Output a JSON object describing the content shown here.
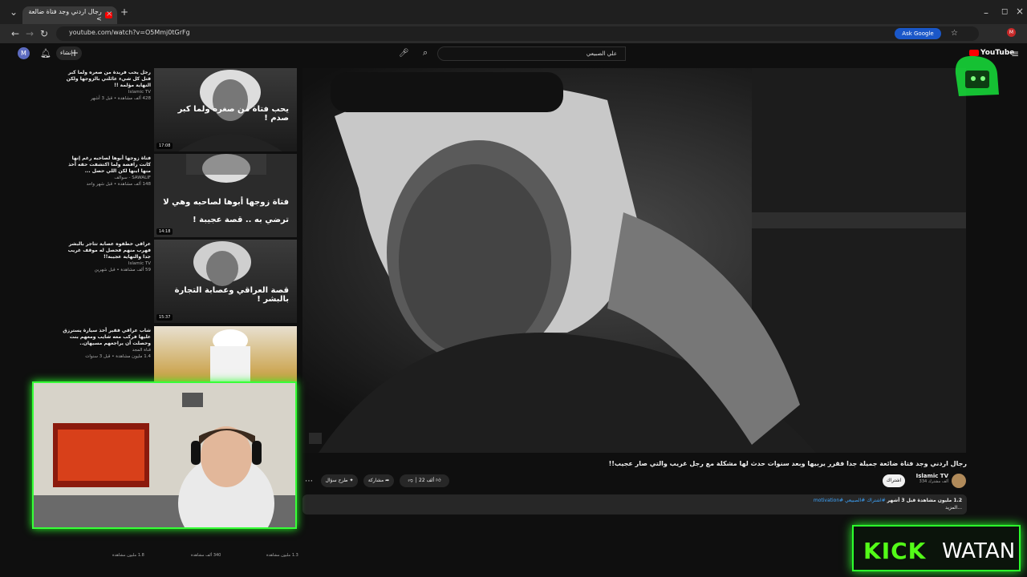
{
  "browser": {
    "tab_title": "رجال اردني وجد فتاة ضالعة >",
    "address": "youtube.com/watch?v=O5Mmj0tGrFg",
    "ask_google": "Ask Google"
  },
  "youtube": {
    "search_value": "علي الصبيعي",
    "create_label": "إنشاء",
    "avatar_letter": "M",
    "logo_text": "YouTube"
  },
  "video": {
    "title": "رجال اردني وجد فتاة ضائعة جميلة جدا فقرر يربيها وبعد سنوات حدث لها مشكلة مع رجل غريب والتي صار عجيب!!",
    "channel": "Islamic TV",
    "subscribers": "334 ألف مشترك",
    "subscribe_label": "اشتراك",
    "likes": "22 ألف",
    "share_label": "مشاركة",
    "ask_label": "طرح سؤال",
    "desc_stats": "1.2 مليون مشاهدة قبل 3 أشهر",
    "desc_tags": "#اشتراك #الصبيعي #motivation",
    "desc_more": "...المزيد"
  },
  "sidebar": [
    {
      "title": "رجل يحب فريدة من صغره ولما كبر قتل كل شيء عائلتي بالزوجها ولكن النهاية مؤلمة !!",
      "channel": "Islamic TV",
      "stats": "428 ألف مشاهدة • قبل 3 أشهر",
      "thumb_caption": "يحب فتاة من صغره ولما كبر صدم !",
      "duration": "17:08"
    },
    {
      "title": "فتاة زوجها أبوها لصاحبه رغم إنها كانت رافضة ولما اكتشفت حقه أخذ منها ابنها لكن اللي حصل ...",
      "channel": "SAWALIF - سوالف",
      "stats": "148 ألف مشاهدة • قبل شهر واحد",
      "thumb_caption": "فتاة زوجها أبوها لصاحبه وهي لا ترضي به .. قصة عجيبة !",
      "duration": "14:18"
    },
    {
      "title": "عراقي خطفوه عصابة تتاجر بالبشر فهرب منهم فحصل له موقف غريب جدا والنهاية عجيبة!!",
      "channel": "Islamic TV",
      "stats": "59 ألف مشاهدة • قبل شهرين",
      "thumb_caption": "قصة العراقي وعصابة التجارة بالبشر !",
      "duration": "15:37"
    },
    {
      "title": "شاب عراقي فقير أخذ سيارة يسترزق عليها فركب معه شايب ومعهم بنت وحصلت أن يراجعهم مسيهان..",
      "channel": "قناة المجد",
      "stats": "1.4 مليون مشاهدة • قبل 3 سنوات",
      "thumb_caption": "",
      "duration": ""
    }
  ],
  "below_stats": [
    "1.8 مليون مشاهدة",
    "340 ألف مشاهدة",
    "1.3 مليون مشاهدة"
  ],
  "overlay": {
    "kick_word": "KICK",
    "watan_word": "WATAN"
  }
}
